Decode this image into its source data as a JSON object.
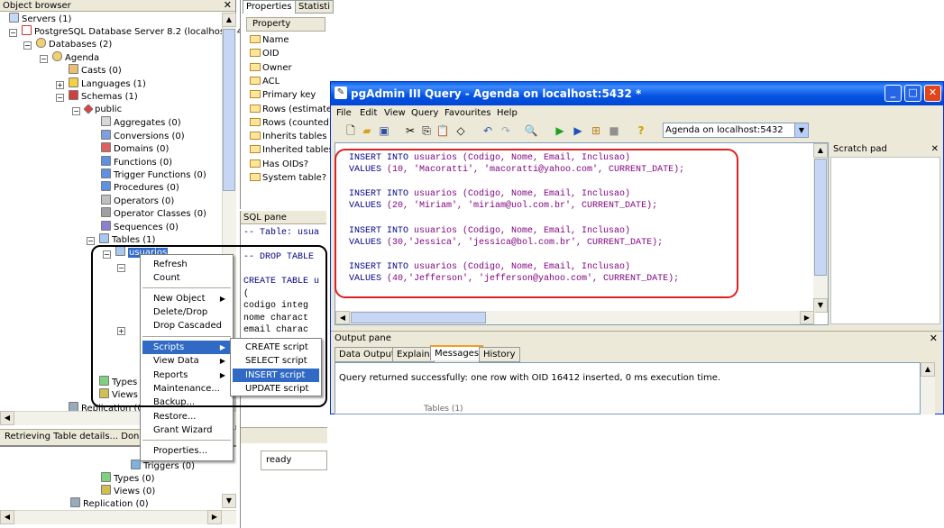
{
  "object_browser": {
    "title": "Object browser",
    "tree": [
      {
        "label": "Servers (1)"
      },
      {
        "label": "PostgreSQL Database Server 8.2 (localhost:54"
      },
      {
        "label": "Databases (2)"
      },
      {
        "label": "Agenda"
      },
      {
        "label": "Casts (0)"
      },
      {
        "label": "Languages (1)"
      },
      {
        "label": "Schemas (1)"
      },
      {
        "label": "public"
      },
      {
        "label": "Aggregates (0)"
      },
      {
        "label": "Conversions (0)"
      },
      {
        "label": "Domains (0)"
      },
      {
        "label": "Functions (0)"
      },
      {
        "label": "Trigger Functions (0)"
      },
      {
        "label": "Procedures (0)"
      },
      {
        "label": "Operators (0)"
      },
      {
        "label": "Operator Classes (0)"
      },
      {
        "label": "Sequences (0)"
      },
      {
        "label": "Tables (1)"
      },
      {
        "label": "usuarios"
      }
    ],
    "lower_tree": [
      "Types",
      "Views",
      "Replication (0)"
    ],
    "status_text": "Retrieving Table details... Done.",
    "bottom_tree": [
      "Triggers (0)",
      "Types (0)",
      "Views (0)",
      "Replication (0)"
    ]
  },
  "properties": {
    "tabs": [
      "Properties",
      "Statisti"
    ],
    "header": "Property",
    "rows": [
      "Name",
      "OID",
      "Owner",
      "ACL",
      "Primary key",
      "Rows (estimate",
      "Rows (counted)",
      "Inherits tables",
      "Inherited tables",
      "Has OIDs?",
      "System table?"
    ]
  },
  "sql_pane": {
    "title": "SQL pane",
    "lines": [
      "-- Table: usua",
      "-- DROP TABLE",
      "CREATE TABLE u",
      "(",
      "  codigo integ",
      "  nome charact",
      "  email charac"
    ]
  },
  "context_menu": {
    "items": [
      "Refresh",
      "Count",
      "New Object",
      "Delete/Drop",
      "Drop Cascaded",
      "Scripts",
      "View Data",
      "Reports",
      "Maintenance...",
      "Backup...",
      "Restore...",
      "Grant Wizard",
      "Properties..."
    ]
  },
  "scripts_submenu": {
    "items": [
      "CREATE script",
      "SELECT script",
      "INSERT script",
      "UPDATE script"
    ]
  },
  "ready_text": "ready",
  "query_window": {
    "title": "pgAdmin III Query - Agenda on localhost:5432 *",
    "menu": [
      "File",
      "Edit",
      "View",
      "Query",
      "Favourites",
      "Help"
    ],
    "connection": "Agenda on localhost:5432",
    "code": [
      {
        "kw": "INSERT INTO",
        "rest": " usuarios (Codigo, Nome, Email, Inclusao)"
      },
      {
        "kw": "VALUES",
        "rest": " (10, 'Macoratti', 'macoratti@yahoo.com', CURRENT_DATE);"
      },
      {
        "kw": "INSERT INTO",
        "rest": " usuarios (Codigo, Nome, Email, Inclusao)"
      },
      {
        "kw": "VALUES",
        "rest": " (20, 'Miriam', 'miriam@uol.com.br', CURRENT_DATE);"
      },
      {
        "kw": "INSERT INTO",
        "rest": " usuarios (Codigo, Nome, Email, Inclusao)"
      },
      {
        "kw": "VALUES",
        "rest": " (30,'Jessica', 'jessica@bol.com.br', CURRENT_DATE);"
      },
      {
        "kw": "INSERT INTO",
        "rest": " usuarios (Codigo, Nome, Email, Inclusao)"
      },
      {
        "kw": "VALUES",
        "rest": " (40,'Jefferson', 'jefferson@yahoo.com', CURRENT_DATE);"
      }
    ],
    "scratch_title": "Scratch pad",
    "output_title": "Output pane",
    "output_tabs": [
      "Data Output",
      "Explain",
      "Messages",
      "History"
    ],
    "output_message": "Query returned successfully: one row with OID 16412 inserted, 0 ms execution time.",
    "behind_text": "Tables (1)"
  },
  "colors": {
    "xp_blue": "#0054e3",
    "highlight": "#316ac5",
    "annotation_red": "#e02020",
    "annotation_black": "#000000"
  }
}
